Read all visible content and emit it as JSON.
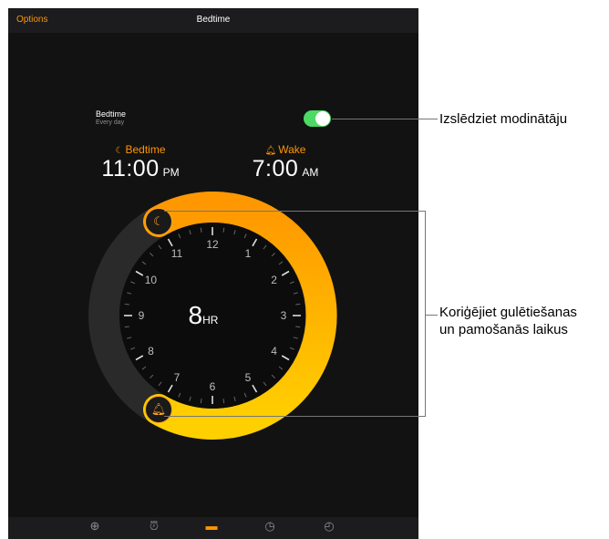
{
  "navbar": {
    "left_button": "Options",
    "title": "Bedtime"
  },
  "bedtime_row": {
    "title": "Bedtime",
    "subtitle": "Every day",
    "toggle_on": true
  },
  "bedtime": {
    "label": "Bedtime",
    "icon": "moon-icon",
    "time": "11:00",
    "ampm": "PM"
  },
  "wake": {
    "label": "Wake",
    "icon": "bell-icon",
    "time": "7:00",
    "ampm": "AM"
  },
  "clock": {
    "numbers": [
      "12",
      "1",
      "2",
      "3",
      "4",
      "5",
      "6",
      "7",
      "8",
      "9",
      "10",
      "11"
    ]
  },
  "duration": {
    "value": "8",
    "unit": "HR"
  },
  "handles": {
    "bedtime_icon": "moon-zzz-icon",
    "wake_icon": "bell-icon"
  },
  "tabs": [
    {
      "icon": "globe-icon",
      "active": false
    },
    {
      "icon": "alarm-clock-icon",
      "active": false
    },
    {
      "icon": "bed-icon",
      "active": true
    },
    {
      "icon": "stopwatch-icon",
      "active": false
    },
    {
      "icon": "timer-icon",
      "active": false
    }
  ],
  "callouts": {
    "toggle": "Izslēdziet modinātāju",
    "adjust_line1": "Koriģējiet gulētiešanas",
    "adjust_line2": "un pamošanās laikus"
  },
  "colors": {
    "accent": "#ff9500",
    "toggle": "#4cd964",
    "background": "#121212"
  }
}
